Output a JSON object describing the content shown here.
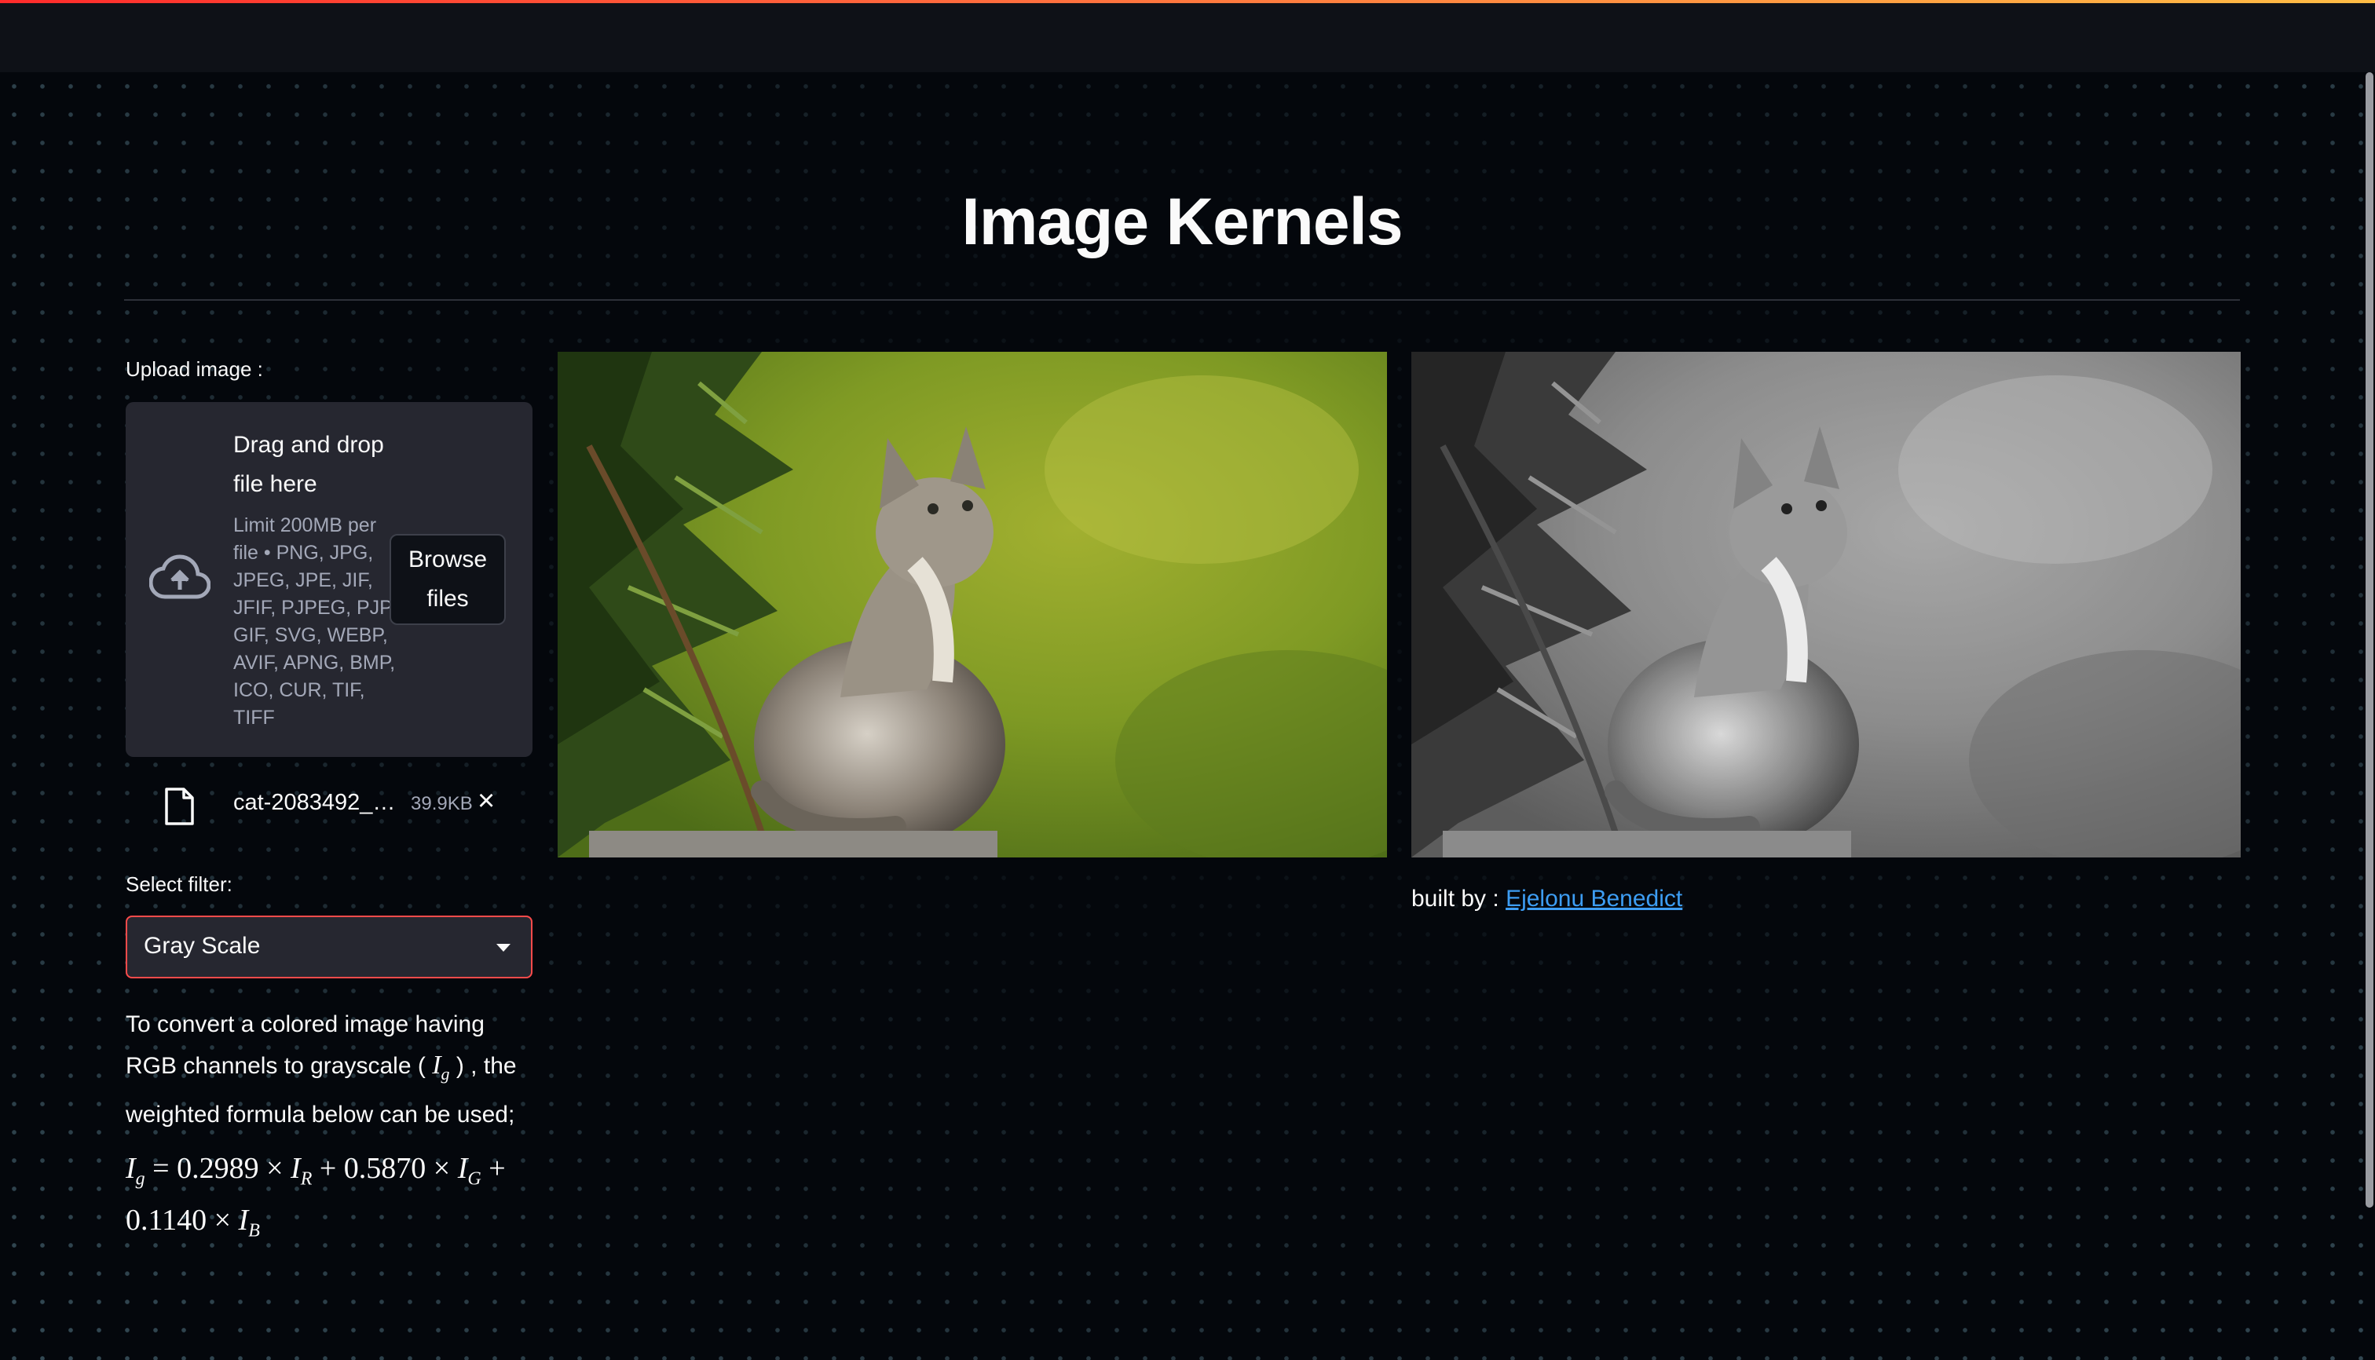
{
  "page": {
    "title": "Image Kernels"
  },
  "upload": {
    "label": "Upload image :",
    "dropzone_title": "Drag and drop file here",
    "limit_text": "Limit 200MB per file • PNG, JPG, JPEG, JPE, JIF, JFIF, PJPEG, PJP, GIF, SVG, WEBP, AVIF, APNG, BMP, ICO, CUR, TIF, TIFF",
    "browse_label": "Browse files",
    "file": {
      "name": "cat-2083492_…",
      "size": "39.9KB",
      "remove_icon": "×"
    }
  },
  "filter": {
    "label": "Select filter:",
    "selected": "Gray Scale",
    "description_before": "To convert a colored image having RGB channels to grayscale (",
    "description_symbol": "I",
    "description_sub": "g",
    "description_after": ") , the weighted formula below can be used;",
    "formula": {
      "lhs": "I",
      "lhs_sub": "g",
      "eq": "=",
      "c1": "0.2989",
      "r": "I",
      "r_sub": "R",
      "c2": "0.5870",
      "g": "I",
      "g_sub": "G",
      "c3": "0.1140",
      "b": "I",
      "b_sub": "B",
      "times": "×",
      "plus": "+"
    }
  },
  "credit": {
    "prefix": "built by : ",
    "author": "Ejelonu Benedict"
  },
  "colors": {
    "accent": "#ff4b4b",
    "link": "#3d9df3",
    "background": "#04070c",
    "panel": "#262730"
  },
  "icons": {
    "upload": "cloud-upload-icon",
    "file": "file-icon",
    "remove": "close-icon",
    "dropdown": "chevron-down-icon"
  }
}
